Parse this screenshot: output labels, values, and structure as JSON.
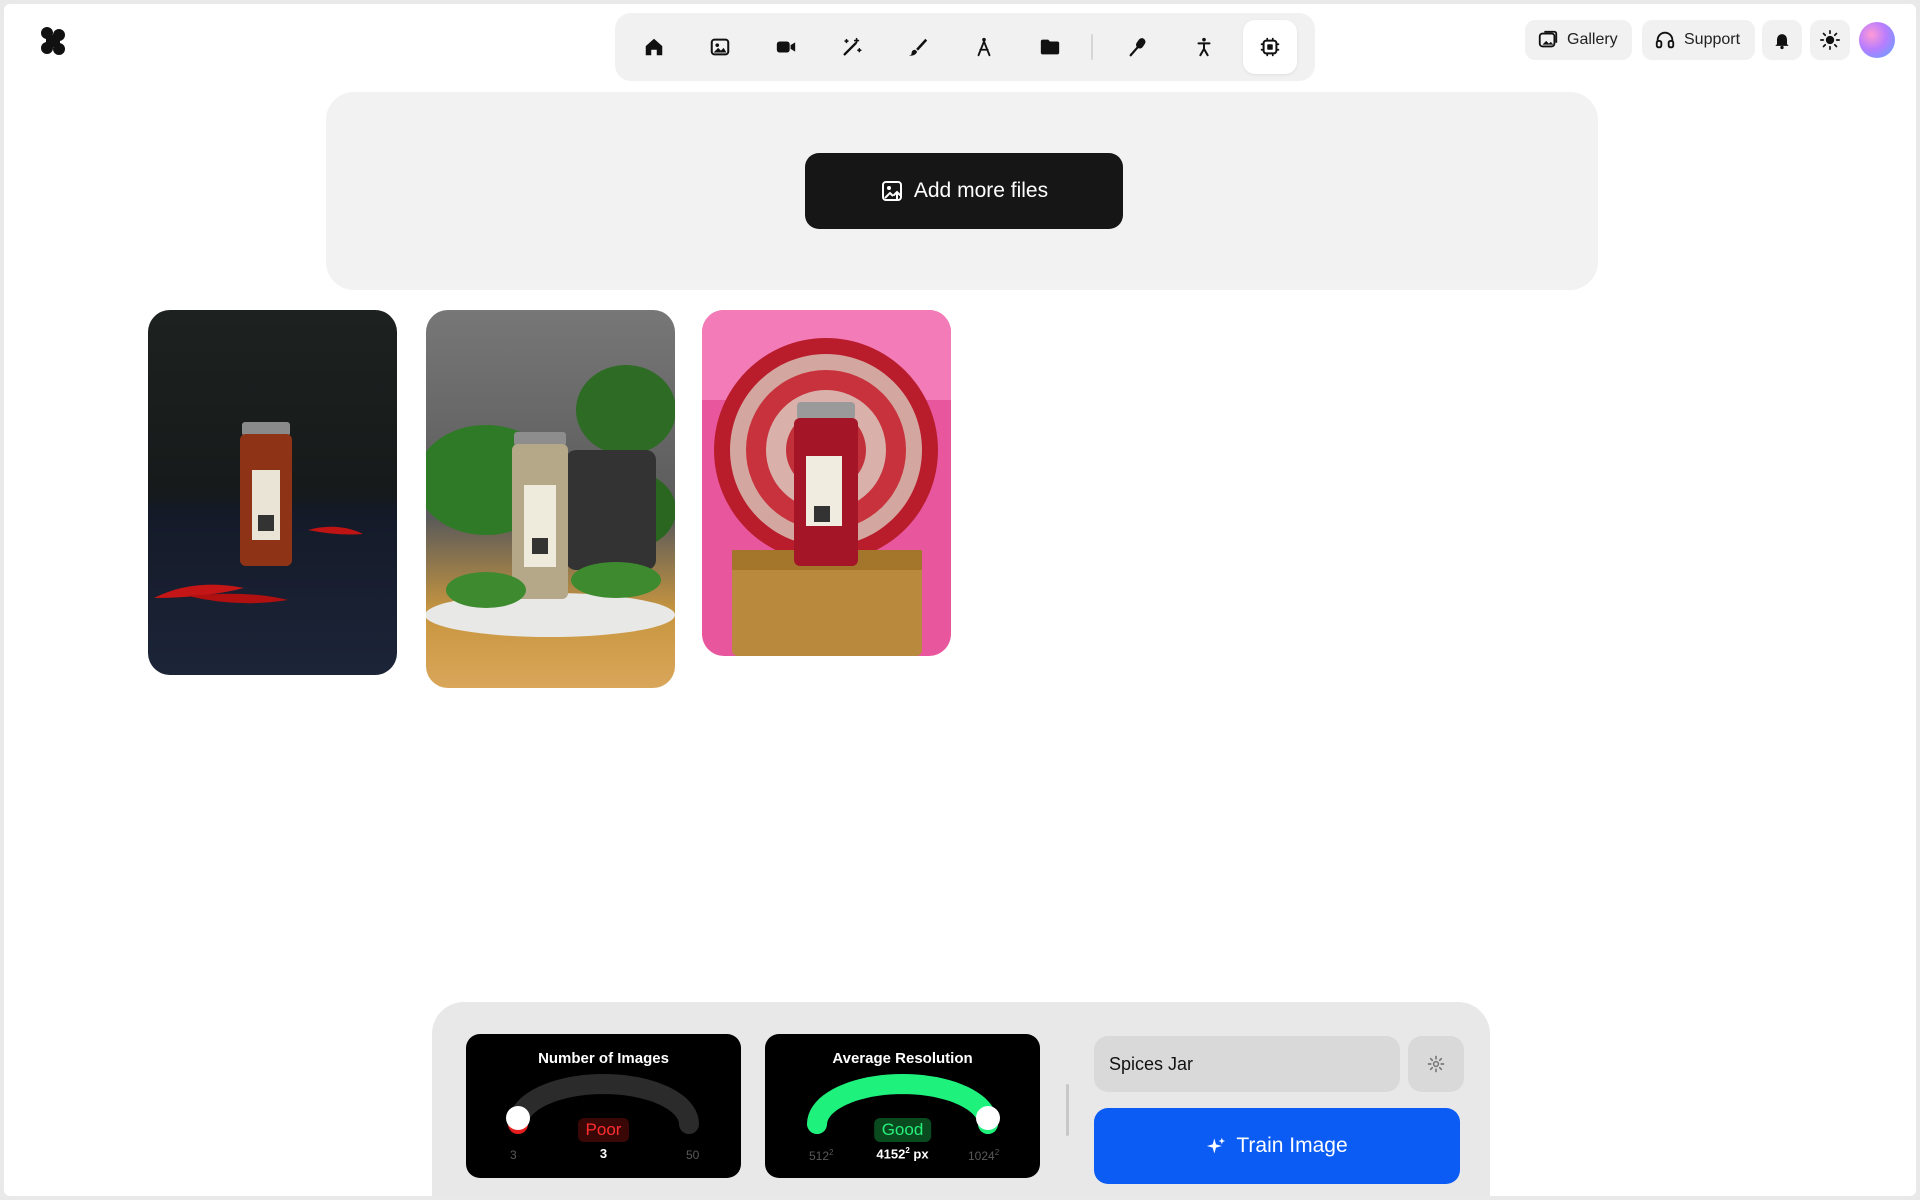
{
  "toolbar": {
    "tools": [
      {
        "icon": "home-icon"
      },
      {
        "icon": "image-icon"
      },
      {
        "icon": "video-camera-icon"
      },
      {
        "icon": "magic-wand-icon"
      },
      {
        "icon": "brush-icon"
      },
      {
        "icon": "compass-icon"
      },
      {
        "icon": "folder-icon"
      },
      {
        "icon": "microphone-icon"
      },
      {
        "icon": "person-icon"
      },
      {
        "icon": "chip-icon",
        "active": true
      }
    ]
  },
  "header": {
    "gallery_label": "Gallery",
    "support_label": "Support"
  },
  "upload": {
    "add_files_label": "Add more files"
  },
  "gallery": {
    "images": [
      {
        "icon": "spice-jar-chili-flakes-photo"
      },
      {
        "icon": "spice-jar-herbs-photo"
      },
      {
        "icon": "spice-jar-red-plate-photo"
      }
    ]
  },
  "stats": {
    "images": {
      "title": "Number of Images",
      "status": "Poor",
      "value": "3",
      "min": "3",
      "max": "50",
      "fraction": 0.0
    },
    "resolution": {
      "title": "Average Resolution",
      "status": "Good",
      "value": "4152",
      "value_unit": "px",
      "min": "512",
      "max": "1024",
      "exponent": "2",
      "fraction": 1.0
    }
  },
  "training": {
    "model_name": "Spices Jar",
    "train_label": "Train Image"
  },
  "colors": {
    "accent": "#0a5cf5",
    "poor": "#ff2d2d",
    "good": "#1ef27c"
  }
}
